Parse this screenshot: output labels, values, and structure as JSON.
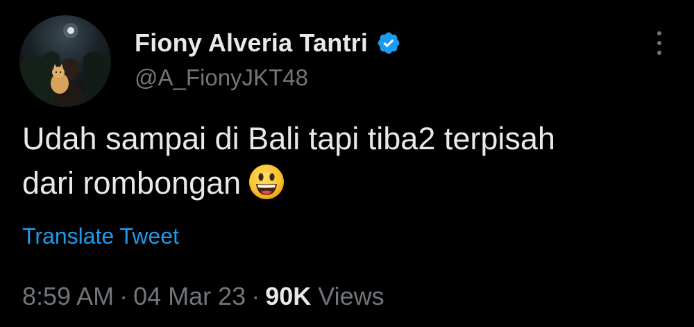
{
  "tweet": {
    "author": {
      "display_name": "Fiony Alveria Tantri",
      "handle": "@A_FionyJKT48",
      "verified": true,
      "avatar_icon": "profile-photo-night-sky-with-cat"
    },
    "text_lines": [
      "Udah sampai di Bali tapi tiba2 terpisah",
      "dari rombongan"
    ],
    "emoji": "grinning-face",
    "translate_label": "Translate Tweet",
    "time": "8:59 AM",
    "separator": "·",
    "date": "04 Mar 23",
    "views_count": "90K",
    "views_label": "Views",
    "more_icon": "more-options-icon"
  },
  "colors": {
    "background": "#000000",
    "primary_text": "#e7e9ea",
    "secondary_text": "#71767b",
    "link": "#1d9bf0",
    "verified_badge": "#1d9bf0"
  }
}
